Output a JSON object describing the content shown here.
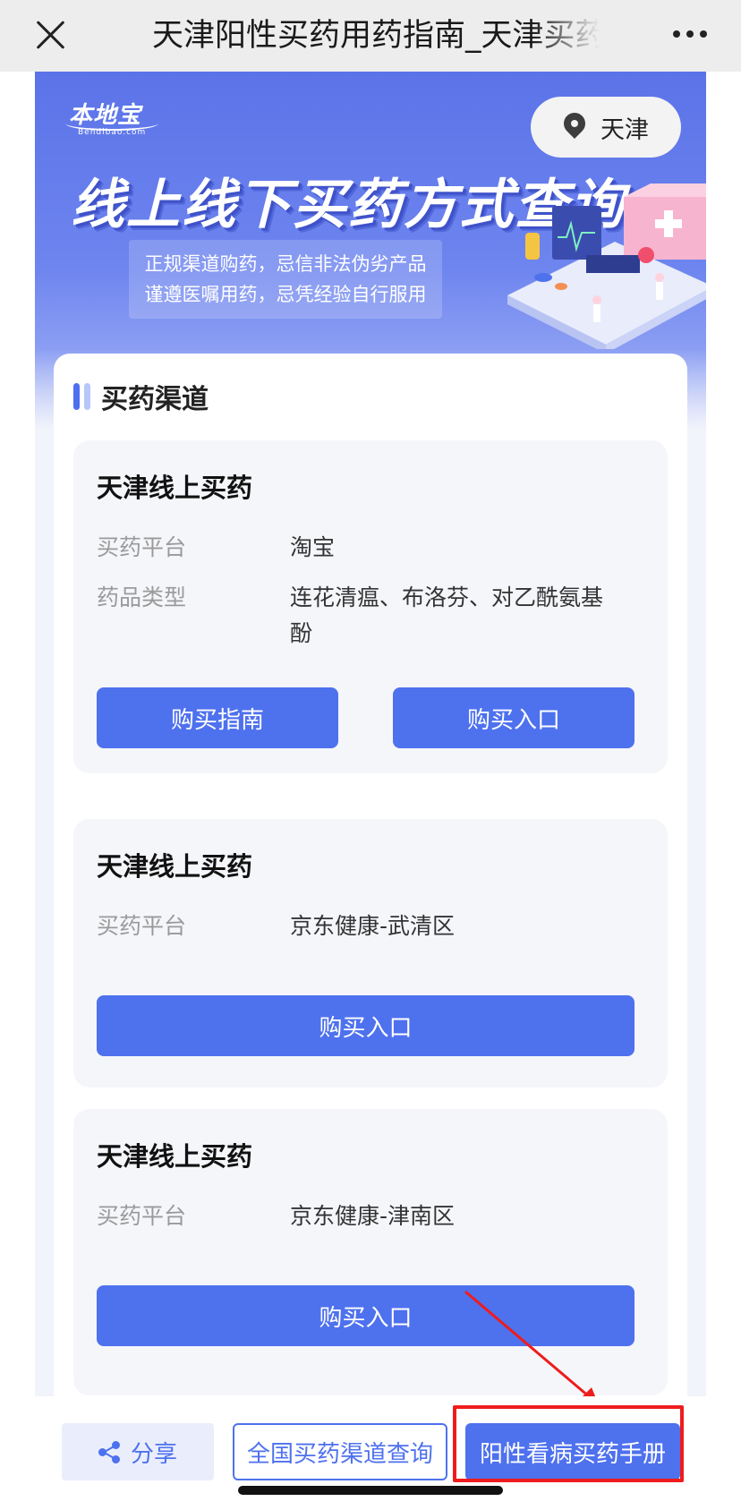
{
  "topbar": {
    "title": "天津阳性买药用药指南_天津买药"
  },
  "banner": {
    "logo_text": "本地宝",
    "logo_sub": "Bendibao.com",
    "city": "天津",
    "title": "线上线下买药方式查询",
    "notice_line1": "正规渠道购药，忌信非法伪劣产品",
    "notice_line2": "谨遵医嘱用药，忌凭经验自行服用"
  },
  "section": {
    "title": "买药渠道"
  },
  "channels": [
    {
      "title": "天津线上买药",
      "platform_label": "买药平台",
      "platform": "淘宝",
      "type_label": "药品类型",
      "type": "连花清瘟、布洛芬、对乙酰氨基酚",
      "guide_label": "购买指南",
      "buy_label": "购买入口"
    },
    {
      "title": "天津线上买药",
      "platform_label": "买药平台",
      "platform": "京东健康-武清区",
      "buy_label": "购买入口"
    },
    {
      "title": "天津线上买药",
      "platform_label": "买药平台",
      "platform": "京东健康-津南区",
      "buy_label": "购买入口"
    }
  ],
  "bottom": {
    "share_label": "分享",
    "nation_label": "全国买药渠道查询",
    "manual_label": "阳性看病买药手册"
  },
  "colors": {
    "accent": "#4e71ee",
    "highlight": "#ee1c1c",
    "banner": "#5b73e8"
  }
}
